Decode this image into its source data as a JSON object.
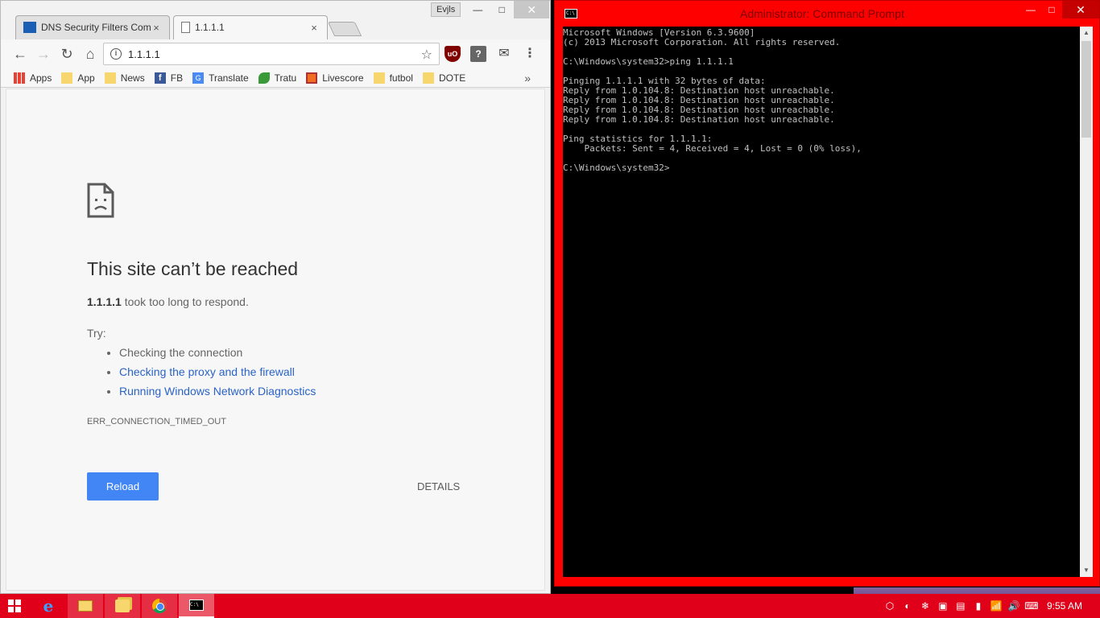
{
  "chrome": {
    "user_badge": "Evjls",
    "tabs": [
      {
        "title": "DNS Security Filters Com",
        "close": "×"
      },
      {
        "title": "1.1.1.1",
        "close": "×"
      }
    ],
    "omnibox_value": "1.1.1.1",
    "bookmarks": [
      {
        "label": "Apps"
      },
      {
        "label": "App"
      },
      {
        "label": "News"
      },
      {
        "label": "FB"
      },
      {
        "label": "Translate"
      },
      {
        "label": "Tratu"
      },
      {
        "label": "Livescore"
      },
      {
        "label": "futbol"
      },
      {
        "label": "DOTE"
      }
    ],
    "bookmarks_more": "»",
    "error": {
      "title": "This site can’t be reached",
      "host": "1.1.1.1",
      "desc_rest": " took too long to respond.",
      "try_label": "Try:",
      "suggestions": [
        "Checking the connection",
        "Checking the proxy and the firewall",
        "Running Windows Network Diagnostics"
      ],
      "code": "ERR_CONNECTION_TIMED_OUT",
      "reload_label": "Reload",
      "details_label": "DETAILS"
    }
  },
  "cmd": {
    "title": "Administrator: Command Prompt",
    "lines": [
      "Microsoft Windows [Version 6.3.9600]",
      "(c) 2013 Microsoft Corporation. All rights reserved.",
      "",
      "C:\\Windows\\system32>ping 1.1.1.1",
      "",
      "Pinging 1.1.1.1 with 32 bytes of data:",
      "Reply from 1.0.104.8: Destination host unreachable.",
      "Reply from 1.0.104.8: Destination host unreachable.",
      "Reply from 1.0.104.8: Destination host unreachable.",
      "Reply from 1.0.104.8: Destination host unreachable.",
      "",
      "Ping statistics for 1.1.1.1:",
      "    Packets: Sent = 4, Received = 4, Lost = 0 (0% loss),",
      "",
      "C:\\Windows\\system32>"
    ]
  },
  "taskbar": {
    "clock": "9:55 AM",
    "accent": "#e0001a"
  },
  "colors": {
    "link": "#2a63c7",
    "reload_button": "#4285f4",
    "cmd_border": "#ff0000"
  }
}
